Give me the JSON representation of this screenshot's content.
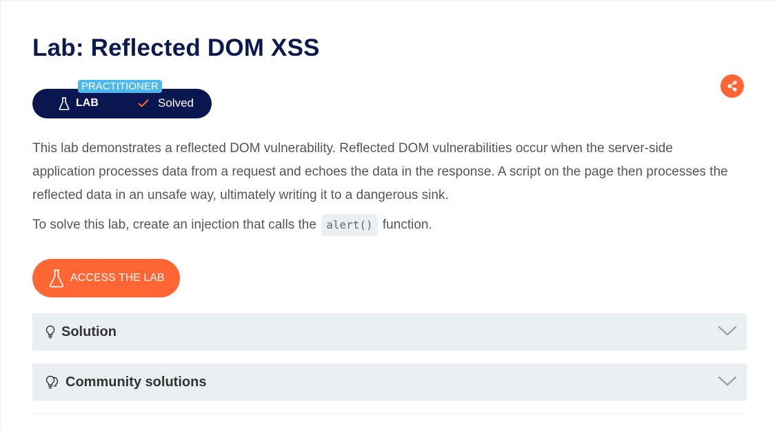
{
  "page": {
    "title": "Lab: Reflected DOM XSS"
  },
  "badge": {
    "level": "PRACTITIONER",
    "type_label": "LAB",
    "status": "Solved"
  },
  "description": {
    "paragraph": "This lab demonstrates a reflected DOM vulnerability. Reflected DOM vulnerabilities occur when the server-side application processes data from a request and echoes the data in the response. A script on the page then processes the reflected data in an unsafe way, ultimately writing it to a dangerous sink.",
    "task_before": "To solve this lab, create an injection that calls the",
    "task_code": "alert()",
    "task_after": "function."
  },
  "buttons": {
    "access_lab": "ACCESS THE LAB"
  },
  "accordions": [
    {
      "label": "Solution",
      "icon": "lightbulb-icon"
    },
    {
      "label": "Community solutions",
      "icon": "community-lightbulbs-icon"
    }
  ],
  "colors": {
    "title": "#0a1a4f",
    "badge_bg": "#0a1650",
    "level_bg": "#4cb8f0",
    "accent": "#ff6633",
    "accordion_bg": "#eaeff1"
  }
}
